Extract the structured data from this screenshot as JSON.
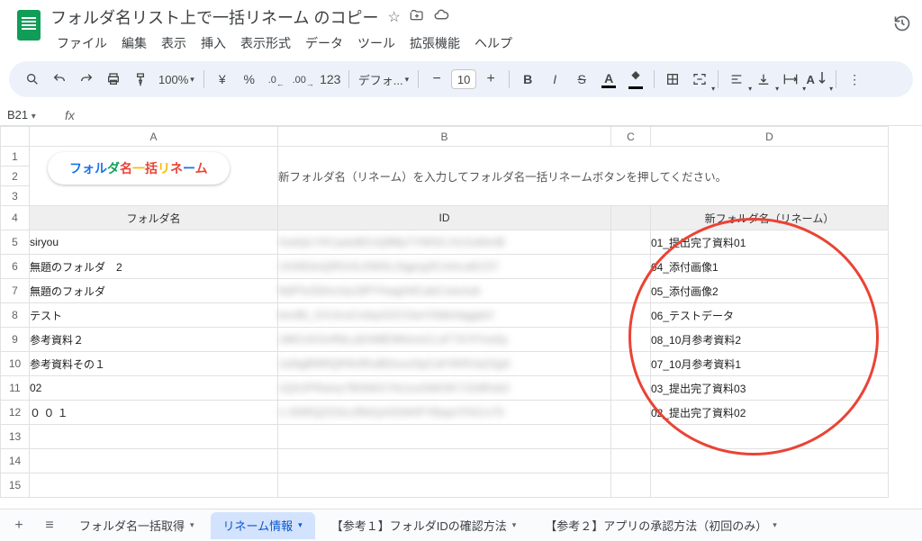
{
  "doc_title": "フォルダ名リスト上で一括リネーム のコピー",
  "menus": [
    "ファイル",
    "編集",
    "表示",
    "挿入",
    "表示形式",
    "データ",
    "ツール",
    "拡張機能",
    "ヘルプ"
  ],
  "toolbar": {
    "zoom": "100%",
    "currency": "¥",
    "percent": "%",
    "font_label": "デフォ...",
    "font_size": "10",
    "dec_dec": ".0",
    "dec_inc": ".00",
    "numfmt": "123"
  },
  "cell_ref": "B21",
  "columns": [
    "A",
    "B",
    "C",
    "D"
  ],
  "row_numbers": [
    1,
    2,
    3,
    4,
    5,
    6,
    7,
    8,
    9,
    10,
    11,
    12,
    13,
    14,
    15
  ],
  "rename_button_chars": [
    "フ",
    "ォ",
    "ル",
    "ダ",
    "名",
    "一",
    "括",
    "リ",
    "ネ",
    "ー",
    "ム"
  ],
  "instruction": "新フォルダ名（リネーム）を入力してフォルダ名一括リネームボタンを押してください。",
  "headers": {
    "a": "フォルダ名",
    "b": "ID",
    "d": "新フォルダ名（リネーム）"
  },
  "rows": [
    {
      "a": "siryou",
      "b": "XwAjILYKCpdsBZvQ9MyTVWSCJt1GaNmB",
      "d": "01_提出完了資料01"
    },
    {
      "a": "無題のフォルダ　2",
      "b": "1A3tEbsQRGOLEMSL2tgprg3Cmhca81SY",
      "d": "04_添付画像1"
    },
    {
      "a": "無題のフォルダ",
      "b": "NdFfsZbfnsXp18PYhwgHilCakCswclub",
      "d": "05_添付画像2"
    },
    {
      "a": "テスト",
      "b": "bonBi_GXJiruCmbyGZCOarVSbbnbggdcf",
      "d": "06_テストデータ"
    },
    {
      "a": "参考資料２",
      "b": "1MG1KGsRbLaEAMEWtimsCLsF7SYFmstly",
      "d": "08_10月参考資料2"
    },
    {
      "a": "参考資料その１",
      "b": "1aNgBNRQfHk3RuBDsosOpCaF4KRJa22gA",
      "d": "07_10月参考資料1"
    },
    {
      "a": "02",
      "b": "1QAJFRamy7BSN01Yb1suObK0K7J2dRob2",
      "d": "03_提出完了資料03"
    },
    {
      "a": "０ ０ １",
      "b": "1-SNRQZOSsJRk5yHGNHPYBwpYFACn70",
      "d": "02_提出完了資料02"
    }
  ],
  "tabs": [
    {
      "label": "フォルダ名一括取得",
      "active": false
    },
    {
      "label": "リネーム情報",
      "active": true
    },
    {
      "label": "【参考１】フォルダIDの確認方法",
      "active": false
    },
    {
      "label": "【参考２】アプリの承認方法（初回のみ）",
      "active": false
    }
  ]
}
